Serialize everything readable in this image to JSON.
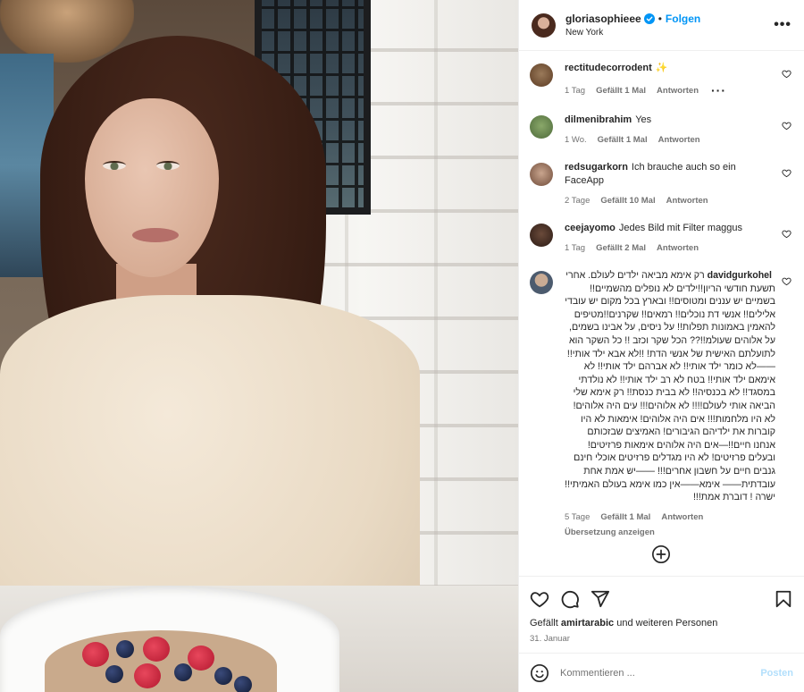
{
  "post": {
    "username": "gloriasophieee",
    "follow_label": "Folgen",
    "location": "New York",
    "more_glyph": "•••"
  },
  "comments": [
    {
      "username": "rectitudecorrodent",
      "text": "✨",
      "time": "1 Tag",
      "likes": "Gefällt 1 Mal",
      "reply": "Antworten",
      "has_more": true
    },
    {
      "username": "dilmenibrahim",
      "text": "Yes",
      "time": "1 Wo.",
      "likes": "Gefällt 1 Mal",
      "reply": "Antworten"
    },
    {
      "username": "redsugarkorn",
      "text": "Ich brauche auch so ein FaceApp",
      "time": "2 Tage",
      "likes": "Gefällt 10 Mal",
      "reply": "Antworten"
    },
    {
      "username": "ceejayomo",
      "text": "Jedes Bild mit Filter maggus",
      "time": "1 Tag",
      "likes": "Gefällt 2 Mal",
      "reply": "Antworten"
    },
    {
      "username": "davidgurkohel",
      "text": "רק אימא מביאה ילדים לעולם. אחרי תשעת חודשי הריון!!ילדים לא נופלים מהשמיים!! בשמיים יש עננים ומטוסים!! ובארץ בכל מקום יש עובדי אלילים!! אנשי דת נוכלים!! רמאים!! שקרנים!!מטיפים להאמין באמונות תפלות!! על ניסים, על אבינו בשמים, על אלוהים שעולמ!!?? הכל שקר וכזב !! כל השקר הוא לתועלתם האישית של אנשי הדת! !!לא אבא ילד אותי!!——לא כומר ילד אותי!! לא אברהם ילד אותי!! לא אימאם ילד אותי!! בטח לא רב ילד אותי!! לא נולדתי במסגד!! לא בכנסיה!! לא בבית כנסת!! רק אימא שלי הביאה אותי לעולם!!!! לא אלוהים!!! עים היה אלוהים! לא היו מלחמות!!! אים היה אלוהים! אימאות לא היו קוברות את ילדיהם הגיבורים! האמיצים שבזכותם אנחנו חיים!!—אים היה אלוהים אימאות פרזיטים! ובעלים פרזיטים! לא היו מגדלים פרזיטים אוכלי חינם גנבים חיים על חשבון אחרים!!! ——יש אמת אחת עובדתית—— אימא——אין כמו אימא בעולם האמיתי!! ישרה ! דוברת אמת!!!",
      "time": "5 Tage",
      "likes": "Gefällt 1 Mal",
      "reply": "Antworten",
      "translate": "Übersetzung anzeigen",
      "rtl": true
    }
  ],
  "footer": {
    "likes_prefix": "Gefällt ",
    "likes_user": "amirtarabic",
    "likes_suffix": " und weiteren Personen",
    "date": "31. Januar",
    "comment_placeholder": "Kommentieren ...",
    "post_label": "Posten"
  },
  "colors": {
    "accent": "#0095f6",
    "muted": "#737373",
    "post_disabled": "#b2dffc"
  }
}
